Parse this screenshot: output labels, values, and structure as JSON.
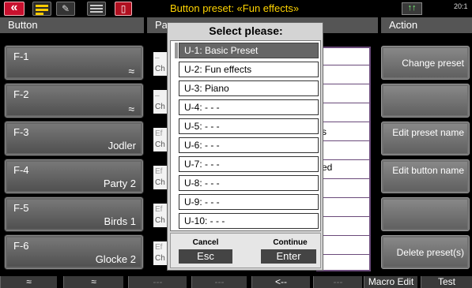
{
  "topbar": {
    "back_icon": "double-chevron-left",
    "edit_icon": "pencil",
    "title": "Button preset: «Fun effects»",
    "clock": "20:1",
    "arrow_label": "↑↑"
  },
  "headers": {
    "button": "Button",
    "param": "Pa",
    "action": "Action"
  },
  "left_buttons": [
    {
      "label": "F-1",
      "sub": "",
      "chevron": "up"
    },
    {
      "label": "F-2",
      "sub": "",
      "chevron": "down"
    },
    {
      "label": "F-3",
      "sub": "Jodler",
      "chevron": ""
    },
    {
      "label": "F-4",
      "sub": "Party 2",
      "chevron": ""
    },
    {
      "label": "F-5",
      "sub": "Birds 1",
      "chevron": ""
    },
    {
      "label": "F-6",
      "sub": "Glocke 2",
      "chevron": ""
    }
  ],
  "mid_cells": [
    "Ch",
    "Ch",
    "Ch",
    "Ch",
    "Ch",
    "Ch"
  ],
  "mid_cells_top": [
    "–",
    "–",
    "Ef",
    "Ef",
    "Ef",
    "Ef"
  ],
  "icons": {
    "chevron_up": "≈",
    "chevron_down": "≈"
  },
  "list_fragments": [
    "s",
    "ed"
  ],
  "right_buttons": [
    {
      "label": "Change preset"
    },
    {
      "label": ""
    },
    {
      "label": "Edit preset name"
    },
    {
      "label": "Edit button name"
    },
    {
      "label": ""
    },
    {
      "label": "Delete preset(s)"
    }
  ],
  "bottombar": [
    {
      "label": "≈",
      "dim": false
    },
    {
      "label": "≈",
      "dim": false
    },
    {
      "label": "---",
      "dim": true
    },
    {
      "label": "---",
      "dim": true
    },
    {
      "label": "<--",
      "dim": false
    },
    {
      "label": "---",
      "dim": true
    },
    {
      "label": "Macro Edit",
      "dim": false
    },
    {
      "label": "Test",
      "dim": false
    }
  ],
  "popup": {
    "title": "Select please:",
    "options": [
      "U-1: Basic Preset",
      "U-2: Fun effects",
      "U-3: Piano",
      "U-4: - - -",
      "U-5: - - -",
      "U-6: - - -",
      "U-7: - - -",
      "U-8: - - -",
      "U-9: - - -",
      "U-10: - - -"
    ],
    "selected_index": 0,
    "cancel_label": "Cancel",
    "cancel_key": "Esc",
    "continue_label": "Continue",
    "continue_key": "Enter"
  }
}
